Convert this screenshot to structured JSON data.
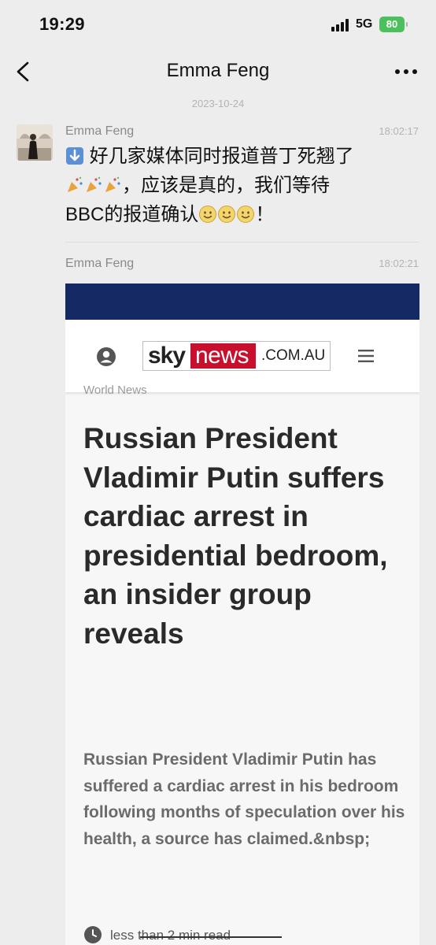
{
  "status_bar": {
    "time": "19:29",
    "network": "5G",
    "battery": "80"
  },
  "nav": {
    "title": "Emma Feng",
    "back_icon": "chevron-left-icon",
    "more_icon": "more-dots-icon"
  },
  "chat": {
    "date": "2023-10-24",
    "messages": [
      {
        "sender": "Emma Feng",
        "time": "18:02:17",
        "line1": "好几家媒体同时报道普丁死翘了",
        "line2": "，应该是真的，我们等待",
        "line3": "BBC的报道确认",
        "line3_end": "！",
        "icons": [
          "down-arrow-emoji",
          "party-popper-emoji",
          "smiling-emoji"
        ]
      },
      {
        "sender": "Emma Feng",
        "time": "18:02:21"
      }
    ]
  },
  "article": {
    "logo_sky": "sky",
    "logo_news": "news",
    "logo_domain": ".COM.AU",
    "category": "World News",
    "headline": "Russian President Vladimir Putin suffers cardiac arrest in presidential bedroom, an insider group reveals",
    "summary": "Russian President Vladimir Putin has suffered a cardiac arrest in his bedroom following months of speculation over his health, a source has claimed.&nbsp;",
    "read_time": "less than 2 min read",
    "colors": {
      "banner": "#152a64",
      "news_red": "#c8102e"
    }
  }
}
